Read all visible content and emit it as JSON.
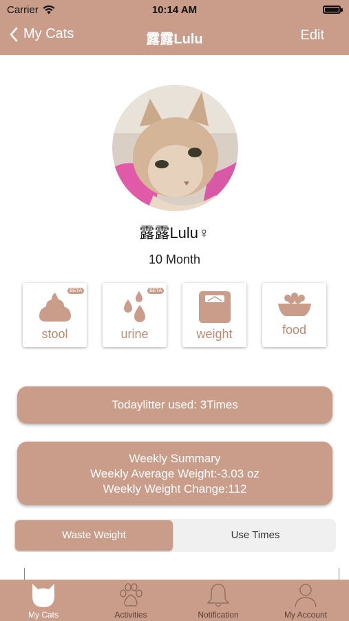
{
  "status_bar": {
    "carrier": "Carrier",
    "time": "10:14 AM"
  },
  "nav": {
    "back_label": "My Cats",
    "title": "露露Lulu",
    "edit_label": "Edit"
  },
  "profile": {
    "name": "露露Lulu♀",
    "age": "10 Month"
  },
  "tiles": [
    {
      "label": "stool",
      "icon": "stool-icon",
      "badge": "BETA"
    },
    {
      "label": "urine",
      "icon": "urine-icon",
      "badge": "BETA"
    },
    {
      "label": "weight",
      "icon": "scale-icon"
    },
    {
      "label": "food",
      "icon": "food-bowl-icon"
    }
  ],
  "litter_card": {
    "text": "Todaylitter used: 3Times"
  },
  "weekly_card": {
    "title": "Weekly Summary",
    "avg_weight": "Weekly Average Weight:-3.03 oz",
    "weight_change": "Weekly Weight Change:112"
  },
  "segment": {
    "active": "Waste Weight",
    "inactive": "Use Times"
  },
  "tabbar": [
    {
      "label": "My Cats",
      "icon": "cat-icon",
      "active": true
    },
    {
      "label": "Activities",
      "icon": "paw-icon"
    },
    {
      "label": "Notification",
      "icon": "bell-icon"
    },
    {
      "label": "My Account",
      "icon": "person-icon"
    }
  ],
  "colors": {
    "accent": "#c99d89",
    "tile_label": "#b88a76",
    "tab_inactive": "#5a4035"
  }
}
